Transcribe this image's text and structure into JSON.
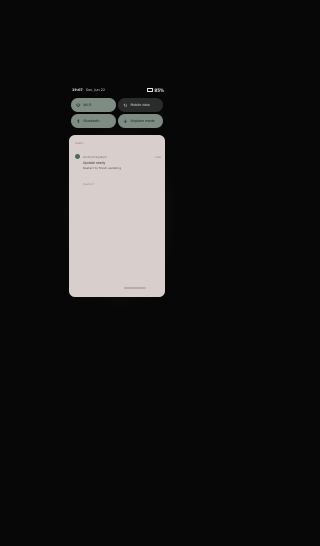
{
  "status_bar": {
    "time": "19:07",
    "date": "Sun, Jun 22",
    "battery": "85%"
  },
  "quick_settings": {
    "tiles": [
      {
        "label": "Wi-Fi",
        "icon": "wifi-icon",
        "state": "on"
      },
      {
        "label": "Mobile data",
        "icon": "mobile-data-icon",
        "state": "off"
      },
      {
        "label": "Bluetooth",
        "icon": "bluetooth-icon",
        "state": "on"
      },
      {
        "label": "Airplane mode",
        "icon": "airplane-icon",
        "state": "on"
      }
    ]
  },
  "notification_panel": {
    "section_label": "Silent",
    "notification": {
      "app": "Android System",
      "time": "now",
      "title": "Update ready",
      "body": "Restart to finish updating",
      "action": "Restart"
    }
  },
  "colors": {
    "tile_on": "#7e8c84",
    "tile_off": "#2a2c2b",
    "panel_bg": "#d8cfcd"
  }
}
